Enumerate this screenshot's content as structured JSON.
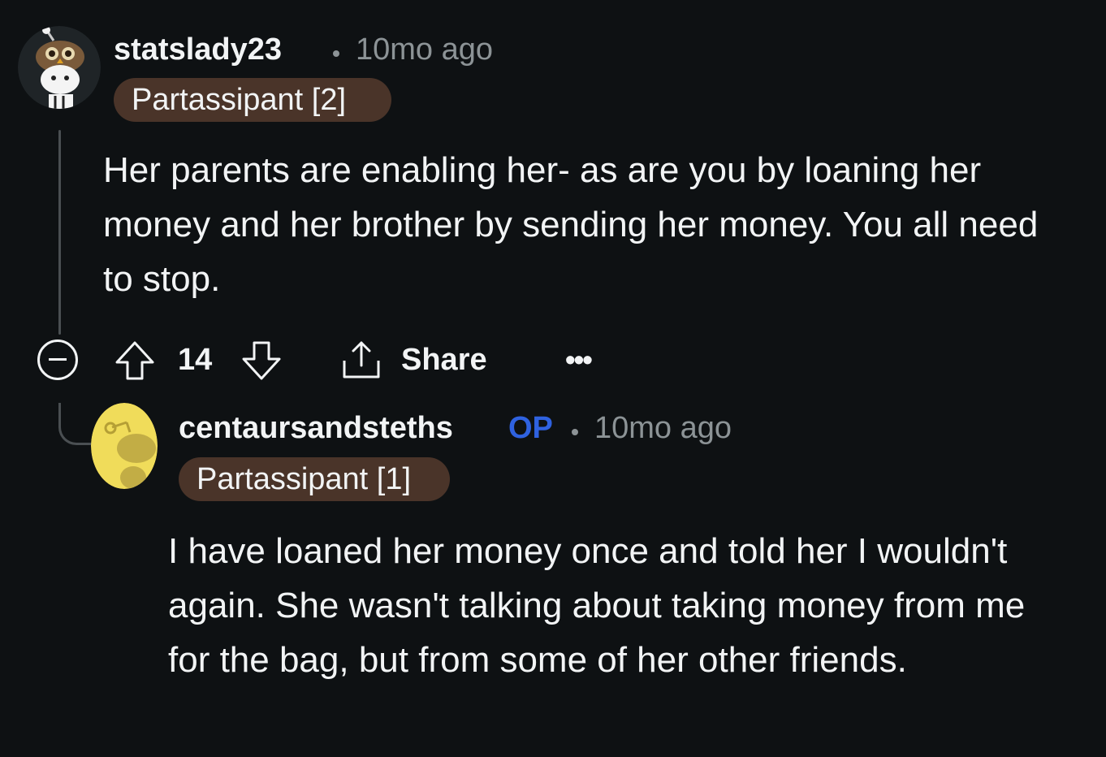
{
  "comment": {
    "username": "statslady23",
    "time": "10mo ago",
    "flair": "Partassipant [2]",
    "body": "Her parents are enabling her- as are you by loaning her money and her brother by sending her money. You all need to stop.",
    "score": "14",
    "share_label": "Share",
    "more_label": "•••",
    "avatar_icon": "snoo-owl-avatar"
  },
  "reply": {
    "username": "centaursandsteths",
    "op_badge": "OP",
    "time": "10mo ago",
    "flair": "Partassipant [1]",
    "body": "I have loaned her money once and told her I wouldn't again. She wasn't talking about taking money from me for the bag, but from some of her other friends.",
    "avatar_icon": "snoo-default-avatar"
  },
  "colors": {
    "background": "#0e1113",
    "flair_bg": "#4a3429",
    "op_blue": "#2f62e0",
    "avatar_yellow": "#f0dc5a",
    "meta_gray": "#8c9396"
  }
}
